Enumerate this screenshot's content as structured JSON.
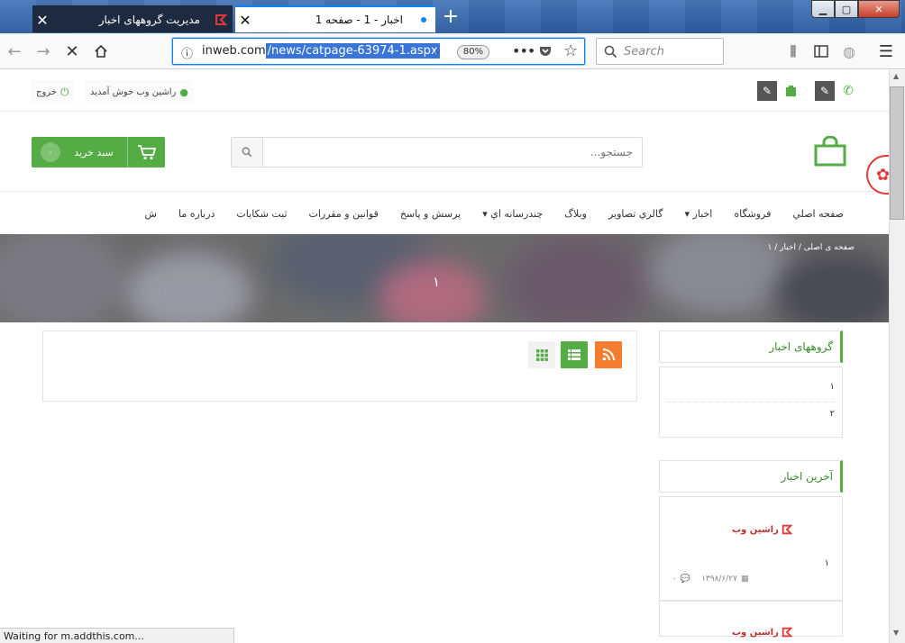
{
  "browser": {
    "tabs": [
      {
        "title": "مدیریت گروههای اخبار",
        "active": false
      },
      {
        "title": "اخبار - 1 - صفحه 1",
        "active": true
      }
    ],
    "url_prefix": "inweb.com",
    "url_selected": "/news/catpage-63974-1.aspx",
    "zoom": "80%",
    "search_placeholder": "Search",
    "status": "Waiting for m.addthis.com..."
  },
  "topbar": {
    "logout": "خروج",
    "welcome": "راشین وب خوش آمدید"
  },
  "header": {
    "cart_label": "سبد خرید",
    "cart_count": "۰",
    "search_placeholder": "جستجو..."
  },
  "menu": [
    {
      "label": "صفحه اصلي"
    },
    {
      "label": "فروشگاه"
    },
    {
      "label": "اخبار ▾"
    },
    {
      "label": "گالري تصاوير"
    },
    {
      "label": "وبلاگ"
    },
    {
      "label": "چندرسانه اي ▾"
    },
    {
      "label": "پرسش و پاسخ"
    },
    {
      "label": "قوانين و مقررات"
    },
    {
      "label": "ثبت شكايات"
    },
    {
      "label": "درباره ما"
    },
    {
      "label": "ش"
    }
  ],
  "hero": {
    "breadcrumb": "صفحه ی اصلی / اخبار / ۱",
    "title": "۱"
  },
  "sidebar": {
    "groups_title": "گروههای اخبار",
    "groups": [
      "۱",
      "۲"
    ],
    "latest_title": "آخرین اخبار",
    "latest": [
      {
        "logo": "راشین وب",
        "title": "۱",
        "date": "۱۳۹۸/۶/۲۷",
        "comments": "۰"
      },
      {
        "logo": "راشین وب"
      }
    ]
  },
  "colors": {
    "accent": "#55ac45",
    "rss": "#f47d30"
  }
}
